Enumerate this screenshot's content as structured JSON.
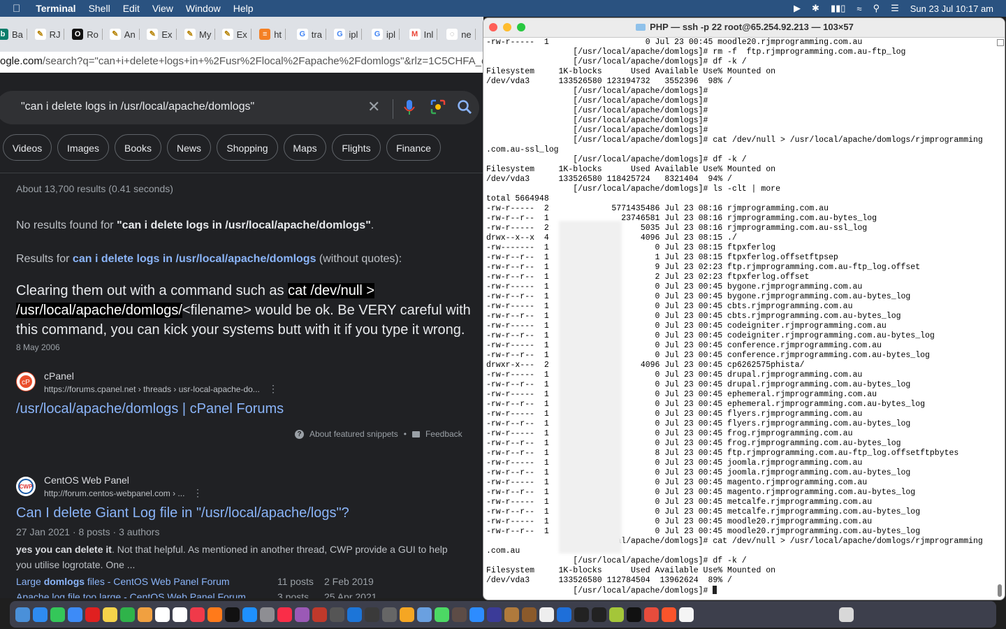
{
  "menubar": {
    "app": "Terminal",
    "items": [
      "Shell",
      "Edit",
      "View",
      "Window",
      "Help"
    ],
    "clock": "Sun 23 Jul  10:17 am"
  },
  "browser": {
    "tabs": [
      {
        "label": "Ba",
        "icon": "bing-icon"
      },
      {
        "label": "RJ",
        "icon": "rjm-icon"
      },
      {
        "label": "Ro",
        "icon": "site-icon"
      },
      {
        "label": "An",
        "icon": "rjm-icon"
      },
      {
        "label": "Ex",
        "icon": "rjm-icon"
      },
      {
        "label": "My",
        "icon": "rjm-icon"
      },
      {
        "label": "Ex",
        "icon": "rjm-icon"
      },
      {
        "label": "ht",
        "icon": "stackoverflow-icon"
      },
      {
        "label": "tra",
        "icon": "google-icon"
      },
      {
        "label": "ipl",
        "icon": "google-icon"
      },
      {
        "label": "ipl",
        "icon": "google-icon"
      },
      {
        "label": "Inl",
        "icon": "gmail-icon"
      },
      {
        "label": "ne",
        "icon": "loading-icon"
      }
    ],
    "url_domain": "ogle.com",
    "url_rest": "/search?q=\"can+i+delete+logs+in+%2Fusr%2Flocal%2Fapache%2Fdomlogs\"&rlz=1C5CHFA_en"
  },
  "google": {
    "query": "\"can i delete logs in /usr/local/apache/domlogs\"",
    "chips": [
      "Videos",
      "Images",
      "Books",
      "News",
      "Shopping",
      "Maps",
      "Flights",
      "Finance"
    ],
    "stats": "About 13,700 results (0.41 seconds)",
    "no_results_prefix": "No results found for ",
    "no_results_query": "\"can i delete logs in /usr/local/apache/domlogs\"",
    "no_results_suffix": ".",
    "results_for_prefix": "Results for ",
    "results_for_query": "can i delete logs in /usr/local/apache/domlogs",
    "results_for_suffix": " (without quotes):",
    "snippet_pre": "Clearing them out with a command such as ",
    "snippet_code1": "cat /dev/null >",
    "snippet_code2": "/usr/local/apache/domlogs/",
    "snippet_post": "<filename> would be ok. Be VERY careful with this command, you can kick your systems butt with it if you type it wrong.",
    "snippet_date": "8 May 2006",
    "result1": {
      "site": "cPanel",
      "url": "https://forums.cpanel.net › threads › usr-local-apache-do...",
      "title": "/usr/local/apache/domlogs | cPanel Forums"
    },
    "about_snippets": "About featured snippets",
    "feedback": "Feedback",
    "result2": {
      "site": "CentOS Web Panel",
      "url": "http://forum.centos-webpanel.com › ...",
      "title": "Can I delete Giant Log file in \"/usr/local/apache/logs\"?",
      "meta": "27 Jan 2021 · 8 posts · 3 authors",
      "desc_bold": "yes you can delete it",
      "desc_rest": ". Not that helpful. As mentioned in another thread, CWP provide a GUI to help you utilise logrotate. One ...",
      "sub1_pre": "Large ",
      "sub1_bold": "domlogs",
      "sub1_post": " files - CentOS Web Panel Forum",
      "sub1_posts": "11 posts",
      "sub1_date": "2 Feb 2019",
      "sub2": "Apache log file too large - CentOS Web Panel Forum",
      "sub2_posts": "3 posts",
      "sub2_date": "25 Apr 2021"
    }
  },
  "terminal": {
    "title": "PHP — ssh -p 22 root@65.254.92.213 — 103×57",
    "lines": [
      "-rw-r-----  1                    0 Jul 23 00:45 moodle20.rjmprogramming.com.au",
      "                  [/usr/local/apache/domlogs]# rm -f  ftp.rjmprogramming.com.au-ftp_log",
      "                  [/usr/local/apache/domlogs]# df -k /",
      "Filesystem     1K-blocks      Used Available Use% Mounted on",
      "/dev/vda3      133526580 123194732   3552396  98% /",
      "                  [/usr/local/apache/domlogs]#",
      "                  [/usr/local/apache/domlogs]#",
      "                  [/usr/local/apache/domlogs]#",
      "                  [/usr/local/apache/domlogs]#",
      "                  [/usr/local/apache/domlogs]#",
      "                  [/usr/local/apache/domlogs]# cat /dev/null > /usr/local/apache/domlogs/rjmprogramming",
      ".com.au-ssl_log",
      "                  [/usr/local/apache/domlogs]# df -k /",
      "Filesystem     1K-blocks      Used Available Use% Mounted on",
      "/dev/vda3      133526580 118425724   8321404  94% /",
      "                  [/usr/local/apache/domlogs]# ls -clt | more",
      "total 5664948",
      "-rw-r-----  2             5771435486 Jul 23 08:16 rjmprogramming.com.au",
      "-rw-r--r--  1               23746581 Jul 23 08:16 rjmprogramming.com.au-bytes_log",
      "-rw-r-----  2                   5035 Jul 23 08:16 rjmprogramming.com.au-ssl_log",
      "drwx--x--x  4                   4096 Jul 23 08:15 ./",
      "-rw-------  1                      0 Jul 23 08:15 ftpxferlog",
      "-rw-r--r--  1                      1 Jul 23 08:15 ftpxferlog.offsetftpsep",
      "-rw-r--r--  1                      9 Jul 23 02:23 ftp.rjmprogramming.com.au-ftp_log.offset",
      "-rw-r--r--  1                      2 Jul 23 02:23 ftpxferlog.offset",
      "-rw-r-----  1                      0 Jul 23 00:45 bygone.rjmprogramming.com.au",
      "-rw-r--r--  1                      0 Jul 23 00:45 bygone.rjmprogramming.com.au-bytes_log",
      "-rw-r-----  1                      0 Jul 23 00:45 cbts.rjmprogramming.com.au",
      "-rw-r--r--  1                      0 Jul 23 00:45 cbts.rjmprogramming.com.au-bytes_log",
      "-rw-r-----  1                      0 Jul 23 00:45 codeigniter.rjmprogramming.com.au",
      "-rw-r--r--  1                      0 Jul 23 00:45 codeigniter.rjmprogramming.com.au-bytes_log",
      "-rw-r-----  1                      0 Jul 23 00:45 conference.rjmprogramming.com.au",
      "-rw-r--r--  1                      0 Jul 23 00:45 conference.rjmprogramming.com.au-bytes_log",
      "drwxr-x---  2                   4096 Jul 23 00:45 cp6262575phista/",
      "-rw-r-----  1                      0 Jul 23 00:45 drupal.rjmprogramming.com.au",
      "-rw-r--r--  1                      0 Jul 23 00:45 drupal.rjmprogramming.com.au-bytes_log",
      "-rw-r-----  1                      0 Jul 23 00:45 ephemeral.rjmprogramming.com.au",
      "-rw-r--r--  1                      0 Jul 23 00:45 ephemeral.rjmprogramming.com.au-bytes_log",
      "-rw-r-----  1                      0 Jul 23 00:45 flyers.rjmprogramming.com.au",
      "-rw-r--r--  1                      0 Jul 23 00:45 flyers.rjmprogramming.com.au-bytes_log",
      "-rw-r-----  1                      0 Jul 23 00:45 frog.rjmprogramming.com.au",
      "-rw-r--r--  1                      0 Jul 23 00:45 frog.rjmprogramming.com.au-bytes_log",
      "-rw-r--r--  1                      8 Jul 23 00:45 ftp.rjmprogramming.com.au-ftp_log.offsetftpbytes",
      "-rw-r-----  1                      0 Jul 23 00:45 joomla.rjmprogramming.com.au",
      "-rw-r--r--  1                      0 Jul 23 00:45 joomla.rjmprogramming.com.au-bytes_log",
      "-rw-r-----  1                      0 Jul 23 00:45 magento.rjmprogramming.com.au",
      "-rw-r--r--  1                      0 Jul 23 00:45 magento.rjmprogramming.com.au-bytes_log",
      "-rw-r-----  1                      0 Jul 23 00:45 metcalfe.rjmprogramming.com.au",
      "-rw-r--r--  1                      0 Jul 23 00:45 metcalfe.rjmprogramming.com.au-bytes_log",
      "-rw-r-----  1                      0 Jul 23 00:45 moodle20.rjmprogramming.com.au",
      "-rw-r--r--  1                      0 Jul 23 00:45 moodle20.rjmprogramming.com.au-bytes_log",
      "                  [/usr/local/apache/domlogs]# cat /dev/null > /usr/local/apache/domlogs/rjmprogramming",
      ".com.au",
      "                  [/usr/local/apache/domlogs]# df -k /",
      "Filesystem     1K-blocks      Used Available Use% Mounted on",
      "/dev/vda3      133526580 112784504  13962624  89% /",
      "                  [/usr/local/apache/domlogs]# "
    ]
  },
  "dock": {
    "icons": [
      "finder-icon",
      "safari-icon",
      "messages-icon",
      "mail-icon",
      "opera-icon",
      "notes-icon",
      "facetime-icon",
      "photos-icon",
      "calendar-icon",
      "reminders-icon",
      "news-icon",
      "firefox-icon",
      "appletv-icon",
      "appstore-icon",
      "settings-icon",
      "music-icon",
      "podcasts-icon",
      "filezilla-icon",
      "calculator-icon",
      "xcode-icon",
      "bbedit-icon",
      "compass-icon",
      "sequelpro-icon",
      "preview-icon",
      "maps-icon",
      "gimp-icon",
      "zoom-icon",
      "vpn-icon",
      "amazon-icon",
      "dictionary-icon",
      "chrome-icon",
      "safari2-icon",
      "inkscape-icon",
      "terminal-icon",
      "android-icon",
      "terminal2-icon",
      "colorsync-icon",
      "brave-icon",
      "document-icon",
      "finder-window-icon",
      "trash-icon"
    ]
  }
}
